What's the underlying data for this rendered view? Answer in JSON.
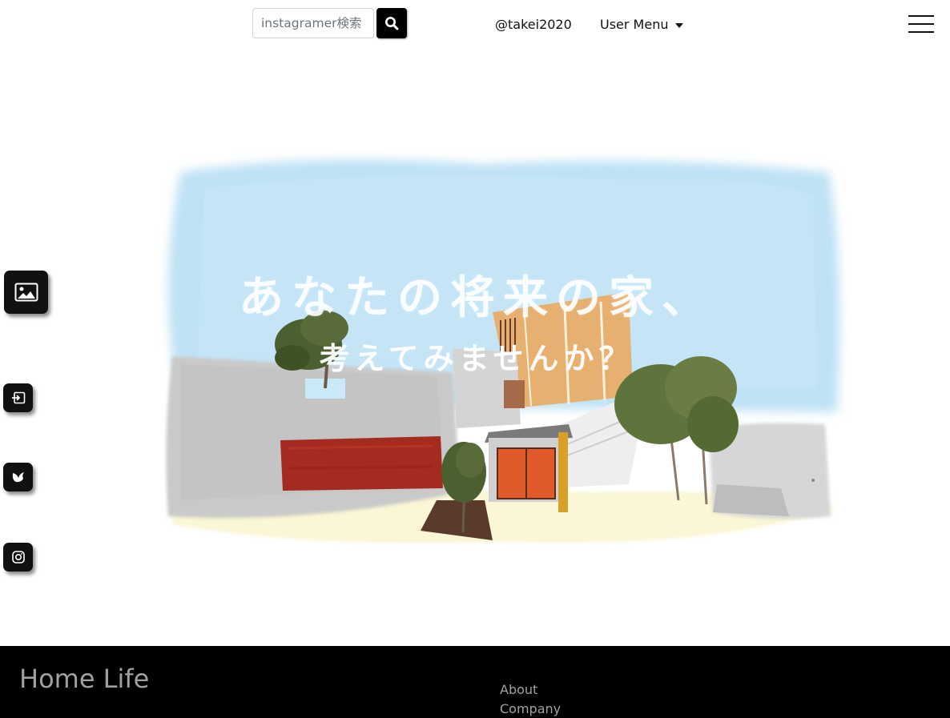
{
  "header": {
    "search": {
      "placeholder": "instagramer検索",
      "value": ""
    },
    "username": "@takei2020",
    "user_menu_label": "User Menu"
  },
  "hero": {
    "title": "あなたの将来の家、",
    "subtitle": "考えてみませんか？"
  },
  "side_buttons": [
    {
      "icon": "image-icon"
    },
    {
      "icon": "login-icon"
    },
    {
      "icon": "bird-icon"
    },
    {
      "icon": "instagram-icon"
    }
  ],
  "footer": {
    "brand": "Home Life",
    "links": [
      "About",
      "Company"
    ]
  },
  "colors": {
    "footer_bg": "#000000",
    "footer_text": "#a0a0a0",
    "sky": "#bfe2f5",
    "wall": "#c8c8c8",
    "garage_door": "#a52a20",
    "house_wood": "#e6b070",
    "tree_green": "#5a6b3a"
  }
}
